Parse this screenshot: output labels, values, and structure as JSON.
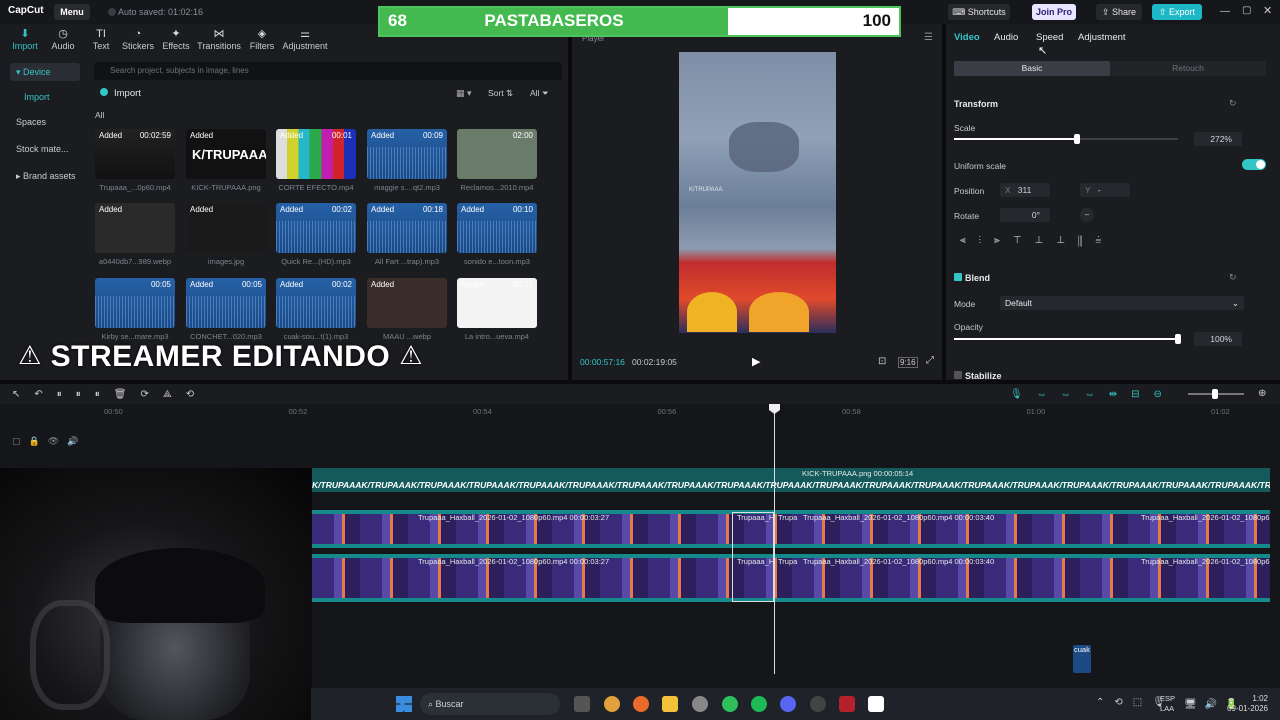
{
  "app": {
    "logo": "CapCut",
    "menu": "Menu",
    "autosave": "Auto saved: 01:02:16"
  },
  "top_right": {
    "shortcuts": "Shortcuts",
    "join_pro": "Join Pro",
    "share": "Share",
    "export": "Export"
  },
  "scoreboard": {
    "left": "68",
    "center": "PASTABASEROS",
    "right": "100",
    "fill_fraction": 0.68
  },
  "toolbar": {
    "items": [
      "Import",
      "Audio",
      "Text",
      "Stickers",
      "Effects",
      "Transitions",
      "Filters",
      "Adjustment"
    ],
    "icons": [
      "import-icon",
      "audio-icon",
      "text-icon",
      "sticker-icon",
      "effects-icon",
      "transitions-icon",
      "filters-icon",
      "adjustment-icon"
    ]
  },
  "sidebar": {
    "items": [
      "Device",
      "Import",
      "Spaces",
      "Stock mate...",
      "Brand assets"
    ]
  },
  "media": {
    "search_placeholder": "Search project, subjects in image, lines",
    "import_label": "Import",
    "sort_label": "Sort",
    "all_filter": "All",
    "all_header": "All",
    "items": [
      {
        "badge": "Added",
        "duration": "00:02:59",
        "name": "Trupaaa_...0p60.mp4"
      },
      {
        "badge": "Added",
        "duration": "",
        "name": "KICK-TRUPAAA.png"
      },
      {
        "badge": "Added",
        "duration": "00:01",
        "name": "CORTE EFECTO.mp4"
      },
      {
        "badge": "Added",
        "duration": "00:09",
        "name": "maggie s....qt2.mp3"
      },
      {
        "badge": "",
        "duration": "02:00",
        "name": "Reclamos...2010.mp4"
      },
      {
        "badge": "Added",
        "duration": "",
        "name": "a0440db7...989.webp"
      },
      {
        "badge": "Added",
        "duration": "",
        "name": "images.jpg"
      },
      {
        "badge": "Added",
        "duration": "00:02",
        "name": "Quick Re...(HD).mp3"
      },
      {
        "badge": "Added",
        "duration": "00:18",
        "name": "All Fart ...trap).mp3"
      },
      {
        "badge": "Added",
        "duration": "00:10",
        "name": "sonido e...toon.mp3"
      },
      {
        "badge": "",
        "duration": "00:05",
        "name": "Kirby se...mare.mp3"
      },
      {
        "badge": "Added",
        "duration": "00:05",
        "name": "CONCHET...020.mp3"
      },
      {
        "badge": "Added",
        "duration": "00:02",
        "name": "cuak-sou...t(1).mp3"
      },
      {
        "badge": "Added",
        "duration": "",
        "name": "MAAU ...webp"
      },
      {
        "badge": "Added",
        "duration": "00:17",
        "name": "La intro...ueva.mp4"
      }
    ]
  },
  "overlay_text": "STREAMER EDITANDO",
  "player": {
    "title": "Player",
    "watermark": "K/TRUPAAA",
    "current_time": "00:00:57:16",
    "total_time": "00:02:19:05",
    "ratio": "9:16"
  },
  "inspector": {
    "tabs": [
      "Video",
      "Audio",
      "Speed",
      "Adjustment"
    ],
    "subtabs": [
      "Basic",
      "Retouch"
    ],
    "transform": {
      "title": "Transform",
      "scale_label": "Scale",
      "scale_value": "272%",
      "scale_fraction": 0.55,
      "uniform_label": "Uniform scale",
      "position_label": "Position",
      "x_label": "X",
      "x_value": "311",
      "y_label": "Y",
      "y_value": "-",
      "rotate_label": "Rotate",
      "rotate_value": "0°"
    },
    "blend": {
      "title": "Blend",
      "mode_label": "Mode",
      "mode_value": "Default",
      "opacity_label": "Opacity",
      "opacity_value": "100%",
      "opacity_fraction": 1.0
    },
    "stabilize": "Stabilize",
    "accent": "#34c5c5"
  },
  "timeline": {
    "ruler": [
      "00:50",
      "00:52",
      "00:54",
      "00:56",
      "00:58",
      "01:00",
      "01:02"
    ],
    "text_clip": "KICK-TRUPAAA.png  00:00:05:14",
    "track_text": "K/TRUPAAA",
    "clips": [
      "Trupaaa_Haxball_2026-01-02_1080p60.mp4  00:00:03:27",
      "Trupaaa_H",
      "Trupa",
      "Trupaaa_Haxball_2026-01-02_1080p60.mp4  00:00:03:40",
      "Trupaaa_Haxball_2026-01-02_1080p6"
    ],
    "audio_clip": "cuak"
  },
  "taskbar": {
    "search": "Buscar",
    "lang": "ESP",
    "region": "LAA",
    "time": "1:02",
    "date": "09-01-2026"
  }
}
